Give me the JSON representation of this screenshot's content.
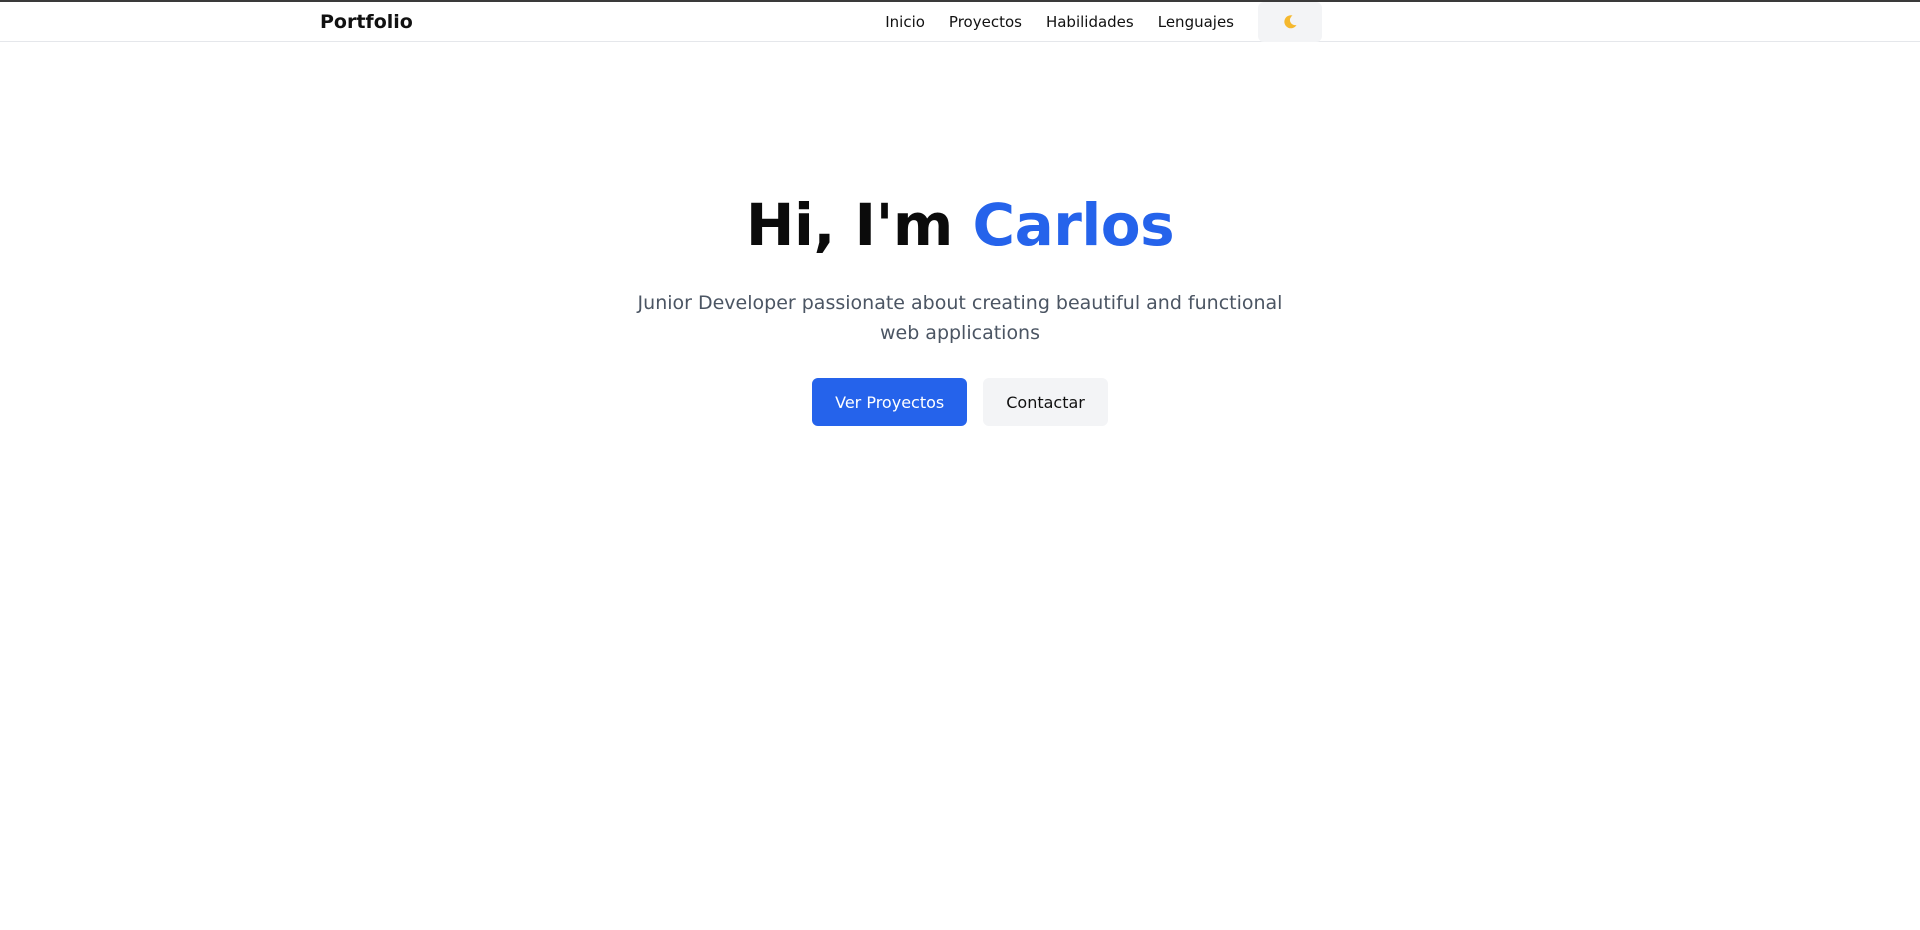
{
  "navbar": {
    "brand": "Portfolio",
    "links": [
      "Inicio",
      "Proyectos",
      "Habilidades",
      "Lenguajes"
    ],
    "theme_toggle_icon": "moon-icon"
  },
  "hero": {
    "title_prefix": "Hi, I'm ",
    "title_name": "Carlos",
    "subtitle": "Junior Developer passionate about creating beautiful and functional web applications",
    "primary_button": "Ver Proyectos",
    "secondary_button": "Contactar"
  },
  "colors": {
    "accent": "#2563eb",
    "muted_text": "#4b5563",
    "secondary_bg": "#f3f4f6"
  }
}
